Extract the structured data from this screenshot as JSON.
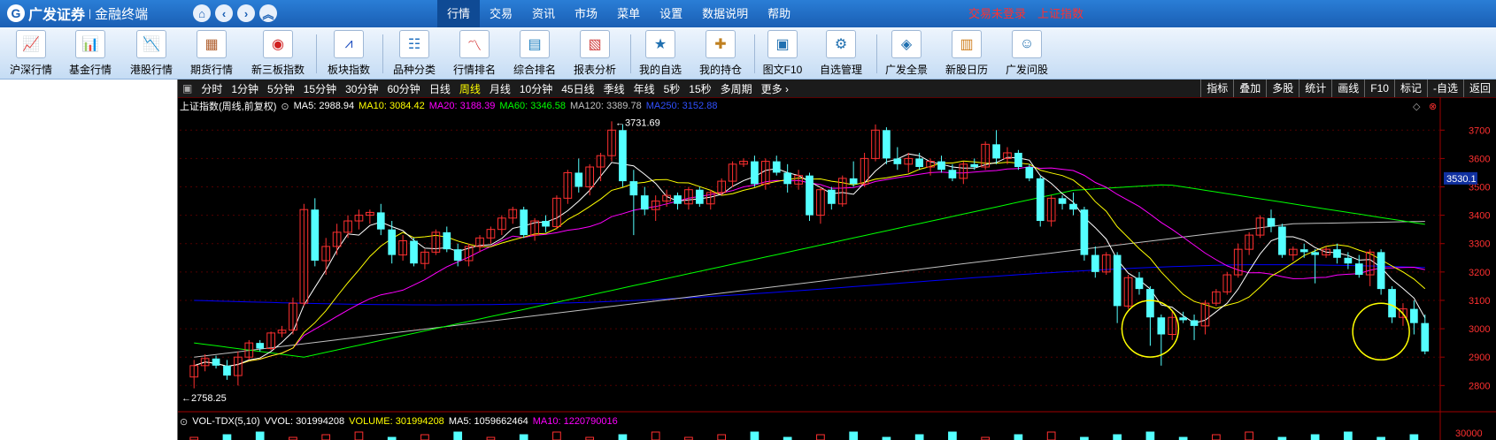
{
  "app": {
    "brand_name": "广发证券",
    "brand_sub": "金融终端",
    "menus": [
      "行情",
      "交易",
      "资讯",
      "市场",
      "菜单",
      "设置",
      "数据说明",
      "帮助"
    ],
    "trade_status": "交易未登录",
    "current_index": "上证指数"
  },
  "toolbar": [
    {
      "label": "沪深行情",
      "icon": "hushen-icon"
    },
    {
      "label": "基金行情",
      "icon": "fund-icon"
    },
    {
      "label": "港股行情",
      "icon": "hk-icon"
    },
    {
      "label": "期货行情",
      "icon": "futures-icon"
    },
    {
      "label": "新三板指数",
      "icon": "neeq-icon"
    },
    {
      "label": "板块指数",
      "icon": "sector-icon"
    },
    {
      "label": "品种分类",
      "icon": "category-icon"
    },
    {
      "label": "行情排名",
      "icon": "ranking-icon"
    },
    {
      "label": "综合排名",
      "icon": "composite-icon"
    },
    {
      "label": "报表分析",
      "icon": "report-icon"
    },
    {
      "label": "我的自选",
      "icon": "watchlist-icon"
    },
    {
      "label": "我的持仓",
      "icon": "holdings-icon"
    },
    {
      "label": "图文F10",
      "icon": "f10-icon"
    },
    {
      "label": "自选管理",
      "icon": "manage-icon"
    },
    {
      "label": "广发全景",
      "icon": "panorama-icon"
    },
    {
      "label": "新股日历",
      "icon": "calendar-icon"
    },
    {
      "label": "广发问股",
      "icon": "ask-icon"
    }
  ],
  "periods": [
    "分时",
    "1分钟",
    "5分钟",
    "15分钟",
    "30分钟",
    "60分钟",
    "日线",
    "周线",
    "月线",
    "10分钟",
    "45日线",
    "季线",
    "年线",
    "5秒",
    "15秒",
    "多周期",
    "更多"
  ],
  "active_period": "周线",
  "right_tools": [
    "指标",
    "叠加",
    "多股",
    "统计",
    "画线",
    "F10",
    "标记",
    "-自选",
    "返回"
  ],
  "indicator": {
    "name": "上证指数(周线,前复权)",
    "ma5": "MA5: 2988.94",
    "ma10": "MA10: 3084.42",
    "ma20": "MA20: 3188.39",
    "ma60": "MA60: 3346.58",
    "ma120": "MA120: 3389.78",
    "ma250": "MA250: 3152.88"
  },
  "volume": {
    "name": "VOL-TDX(5,10)",
    "vvol": "VVOL: 301994208",
    "volume": "VOLUME: 301994208",
    "ma5": "MA5: 1059662464",
    "ma10": "MA10: 1220790016"
  },
  "colors": {
    "up": "#ff3030",
    "down": "#54ffff",
    "ma5": "#ffffff",
    "ma10": "#ffff00",
    "ma20": "#ff00ff",
    "ma60": "#00ff00",
    "ma120": "#c0c0c0",
    "ma250": "#0000ff",
    "circle": "#ffff00"
  },
  "chart_data": {
    "type": "candlestick",
    "title": "上证指数(周线,前复权)",
    "y_ticks": [
      2800,
      2900,
      3000,
      3100,
      3200,
      3300,
      3400,
      3500,
      3600,
      3700
    ],
    "ylim": [
      2720,
      3760
    ],
    "current_price_label": "3530.1",
    "max_label": "3731.69",
    "min_label": "2758.25",
    "volume_axis_label": "30000",
    "candles": [
      {
        "o": 2830,
        "h": 2890,
        "l": 2790,
        "c": 2870
      },
      {
        "o": 2870,
        "h": 2910,
        "l": 2850,
        "c": 2895
      },
      {
        "o": 2895,
        "h": 2905,
        "l": 2860,
        "c": 2870
      },
      {
        "o": 2870,
        "h": 2890,
        "l": 2820,
        "c": 2835
      },
      {
        "o": 2835,
        "h": 2920,
        "l": 2800,
        "c": 2900
      },
      {
        "o": 2900,
        "h": 2960,
        "l": 2890,
        "c": 2950
      },
      {
        "o": 2950,
        "h": 2960,
        "l": 2920,
        "c": 2930
      },
      {
        "o": 2930,
        "h": 2990,
        "l": 2925,
        "c": 2985
      },
      {
        "o": 2985,
        "h": 3010,
        "l": 2970,
        "c": 2995
      },
      {
        "o": 2995,
        "h": 3110,
        "l": 2980,
        "c": 3090
      },
      {
        "o": 3090,
        "h": 3440,
        "l": 3080,
        "c": 3420
      },
      {
        "o": 3420,
        "h": 3460,
        "l": 3220,
        "c": 3240
      },
      {
        "o": 3240,
        "h": 3320,
        "l": 3190,
        "c": 3290
      },
      {
        "o": 3290,
        "h": 3370,
        "l": 3260,
        "c": 3340
      },
      {
        "o": 3340,
        "h": 3400,
        "l": 3320,
        "c": 3380
      },
      {
        "o": 3380,
        "h": 3420,
        "l": 3350,
        "c": 3400
      },
      {
        "o": 3400,
        "h": 3420,
        "l": 3370,
        "c": 3410
      },
      {
        "o": 3410,
        "h": 3440,
        "l": 3330,
        "c": 3350
      },
      {
        "o": 3350,
        "h": 3380,
        "l": 3230,
        "c": 3260
      },
      {
        "o": 3260,
        "h": 3330,
        "l": 3240,
        "c": 3310
      },
      {
        "o": 3310,
        "h": 3320,
        "l": 3220,
        "c": 3230
      },
      {
        "o": 3230,
        "h": 3280,
        "l": 3210,
        "c": 3270
      },
      {
        "o": 3270,
        "h": 3350,
        "l": 3260,
        "c": 3340
      },
      {
        "o": 3340,
        "h": 3360,
        "l": 3270,
        "c": 3280
      },
      {
        "o": 3280,
        "h": 3300,
        "l": 3220,
        "c": 3240
      },
      {
        "o": 3240,
        "h": 3300,
        "l": 3220,
        "c": 3290
      },
      {
        "o": 3290,
        "h": 3330,
        "l": 3270,
        "c": 3320
      },
      {
        "o": 3320,
        "h": 3360,
        "l": 3300,
        "c": 3350
      },
      {
        "o": 3350,
        "h": 3400,
        "l": 3330,
        "c": 3390
      },
      {
        "o": 3390,
        "h": 3430,
        "l": 3370,
        "c": 3420
      },
      {
        "o": 3420,
        "h": 3430,
        "l": 3320,
        "c": 3330
      },
      {
        "o": 3330,
        "h": 3390,
        "l": 3310,
        "c": 3380
      },
      {
        "o": 3380,
        "h": 3400,
        "l": 3340,
        "c": 3360
      },
      {
        "o": 3360,
        "h": 3470,
        "l": 3350,
        "c": 3460
      },
      {
        "o": 3460,
        "h": 3560,
        "l": 3440,
        "c": 3550
      },
      {
        "o": 3550,
        "h": 3600,
        "l": 3480,
        "c": 3500
      },
      {
        "o": 3500,
        "h": 3580,
        "l": 3470,
        "c": 3570
      },
      {
        "o": 3570,
        "h": 3620,
        "l": 3520,
        "c": 3610
      },
      {
        "o": 3610,
        "h": 3731,
        "l": 3590,
        "c": 3700
      },
      {
        "o": 3700,
        "h": 3720,
        "l": 3500,
        "c": 3520
      },
      {
        "o": 3520,
        "h": 3560,
        "l": 3330,
        "c": 3470
      },
      {
        "o": 3470,
        "h": 3500,
        "l": 3400,
        "c": 3420
      },
      {
        "o": 3420,
        "h": 3470,
        "l": 3380,
        "c": 3450
      },
      {
        "o": 3450,
        "h": 3490,
        "l": 3430,
        "c": 3470
      },
      {
        "o": 3470,
        "h": 3480,
        "l": 3420,
        "c": 3440
      },
      {
        "o": 3440,
        "h": 3500,
        "l": 3420,
        "c": 3490
      },
      {
        "o": 3490,
        "h": 3500,
        "l": 3430,
        "c": 3440
      },
      {
        "o": 3440,
        "h": 3490,
        "l": 3420,
        "c": 3480
      },
      {
        "o": 3480,
        "h": 3530,
        "l": 3470,
        "c": 3520
      },
      {
        "o": 3520,
        "h": 3590,
        "l": 3500,
        "c": 3580
      },
      {
        "o": 3580,
        "h": 3600,
        "l": 3570,
        "c": 3590
      },
      {
        "o": 3590,
        "h": 3610,
        "l": 3500,
        "c": 3510
      },
      {
        "o": 3510,
        "h": 3600,
        "l": 3490,
        "c": 3590
      },
      {
        "o": 3590,
        "h": 3610,
        "l": 3540,
        "c": 3550
      },
      {
        "o": 3550,
        "h": 3580,
        "l": 3480,
        "c": 3510
      },
      {
        "o": 3510,
        "h": 3560,
        "l": 3490,
        "c": 3540
      },
      {
        "o": 3540,
        "h": 3550,
        "l": 3380,
        "c": 3400
      },
      {
        "o": 3400,
        "h": 3500,
        "l": 3370,
        "c": 3490
      },
      {
        "o": 3490,
        "h": 3500,
        "l": 3420,
        "c": 3440
      },
      {
        "o": 3440,
        "h": 3540,
        "l": 3430,
        "c": 3530
      },
      {
        "o": 3530,
        "h": 3590,
        "l": 3500,
        "c": 3510
      },
      {
        "o": 3510,
        "h": 3620,
        "l": 3500,
        "c": 3600
      },
      {
        "o": 3600,
        "h": 3720,
        "l": 3590,
        "c": 3700
      },
      {
        "o": 3700,
        "h": 3710,
        "l": 3580,
        "c": 3600
      },
      {
        "o": 3600,
        "h": 3640,
        "l": 3560,
        "c": 3580
      },
      {
        "o": 3580,
        "h": 3620,
        "l": 3550,
        "c": 3600
      },
      {
        "o": 3600,
        "h": 3620,
        "l": 3560,
        "c": 3570
      },
      {
        "o": 3570,
        "h": 3600,
        "l": 3540,
        "c": 3590
      },
      {
        "o": 3590,
        "h": 3610,
        "l": 3550,
        "c": 3560
      },
      {
        "o": 3560,
        "h": 3580,
        "l": 3520,
        "c": 3530
      },
      {
        "o": 3530,
        "h": 3590,
        "l": 3510,
        "c": 3580
      },
      {
        "o": 3580,
        "h": 3600,
        "l": 3560,
        "c": 3570
      },
      {
        "o": 3570,
        "h": 3660,
        "l": 3560,
        "c": 3650
      },
      {
        "o": 3650,
        "h": 3700,
        "l": 3580,
        "c": 3600
      },
      {
        "o": 3600,
        "h": 3640,
        "l": 3580,
        "c": 3620
      },
      {
        "o": 3620,
        "h": 3630,
        "l": 3560,
        "c": 3570
      },
      {
        "o": 3570,
        "h": 3580,
        "l": 3520,
        "c": 3530
      },
      {
        "o": 3530,
        "h": 3540,
        "l": 3360,
        "c": 3380
      },
      {
        "o": 3380,
        "h": 3470,
        "l": 3360,
        "c": 3460
      },
      {
        "o": 3460,
        "h": 3470,
        "l": 3420,
        "c": 3440
      },
      {
        "o": 3440,
        "h": 3480,
        "l": 3400,
        "c": 3420
      },
      {
        "o": 3420,
        "h": 3430,
        "l": 3240,
        "c": 3260
      },
      {
        "o": 3260,
        "h": 3290,
        "l": 3180,
        "c": 3200
      },
      {
        "o": 3200,
        "h": 3270,
        "l": 3190,
        "c": 3260
      },
      {
        "o": 3260,
        "h": 3270,
        "l": 3020,
        "c": 3080
      },
      {
        "o": 3080,
        "h": 3190,
        "l": 3070,
        "c": 3180
      },
      {
        "o": 3180,
        "h": 3200,
        "l": 3120,
        "c": 3140
      },
      {
        "o": 3140,
        "h": 3150,
        "l": 2940,
        "c": 3040
      },
      {
        "o": 3040,
        "h": 3050,
        "l": 2870,
        "c": 2980
      },
      {
        "o": 2980,
        "h": 3060,
        "l": 2960,
        "c": 3040
      },
      {
        "o": 3040,
        "h": 3060,
        "l": 3020,
        "c": 3030
      },
      {
        "o": 3030,
        "h": 3050,
        "l": 2960,
        "c": 3010
      },
      {
        "o": 3010,
        "h": 3100,
        "l": 2980,
        "c": 3090
      },
      {
        "o": 3090,
        "h": 3140,
        "l": 3080,
        "c": 3130
      },
      {
        "o": 3130,
        "h": 3200,
        "l": 3120,
        "c": 3190
      },
      {
        "o": 3190,
        "h": 3300,
        "l": 3180,
        "c": 3280
      },
      {
        "o": 3280,
        "h": 3340,
        "l": 3260,
        "c": 3330
      },
      {
        "o": 3330,
        "h": 3400,
        "l": 3320,
        "c": 3390
      },
      {
        "o": 3390,
        "h": 3420,
        "l": 3340,
        "c": 3360
      },
      {
        "o": 3360,
        "h": 3370,
        "l": 3250,
        "c": 3260
      },
      {
        "o": 3260,
        "h": 3290,
        "l": 3240,
        "c": 3280
      },
      {
        "o": 3280,
        "h": 3300,
        "l": 3250,
        "c": 3270
      },
      {
        "o": 3270,
        "h": 3280,
        "l": 3160,
        "c": 3260
      },
      {
        "o": 3260,
        "h": 3290,
        "l": 3250,
        "c": 3280
      },
      {
        "o": 3280,
        "h": 3300,
        "l": 3230,
        "c": 3250
      },
      {
        "o": 3250,
        "h": 3270,
        "l": 3210,
        "c": 3230
      },
      {
        "o": 3230,
        "h": 3260,
        "l": 3180,
        "c": 3190
      },
      {
        "o": 3190,
        "h": 3280,
        "l": 3150,
        "c": 3270
      },
      {
        "o": 3270,
        "h": 3280,
        "l": 3120,
        "c": 3140
      },
      {
        "o": 3140,
        "h": 3150,
        "l": 3020,
        "c": 3040
      },
      {
        "o": 3040,
        "h": 3090,
        "l": 3010,
        "c": 3070
      },
      {
        "o": 3070,
        "h": 3100,
        "l": 2980,
        "c": 3020
      },
      {
        "o": 3020,
        "h": 3050,
        "l": 2910,
        "c": 2920
      }
    ],
    "circles": [
      {
        "index": 87,
        "price": 3000
      },
      {
        "index": 108,
        "price": 2990
      }
    ]
  }
}
